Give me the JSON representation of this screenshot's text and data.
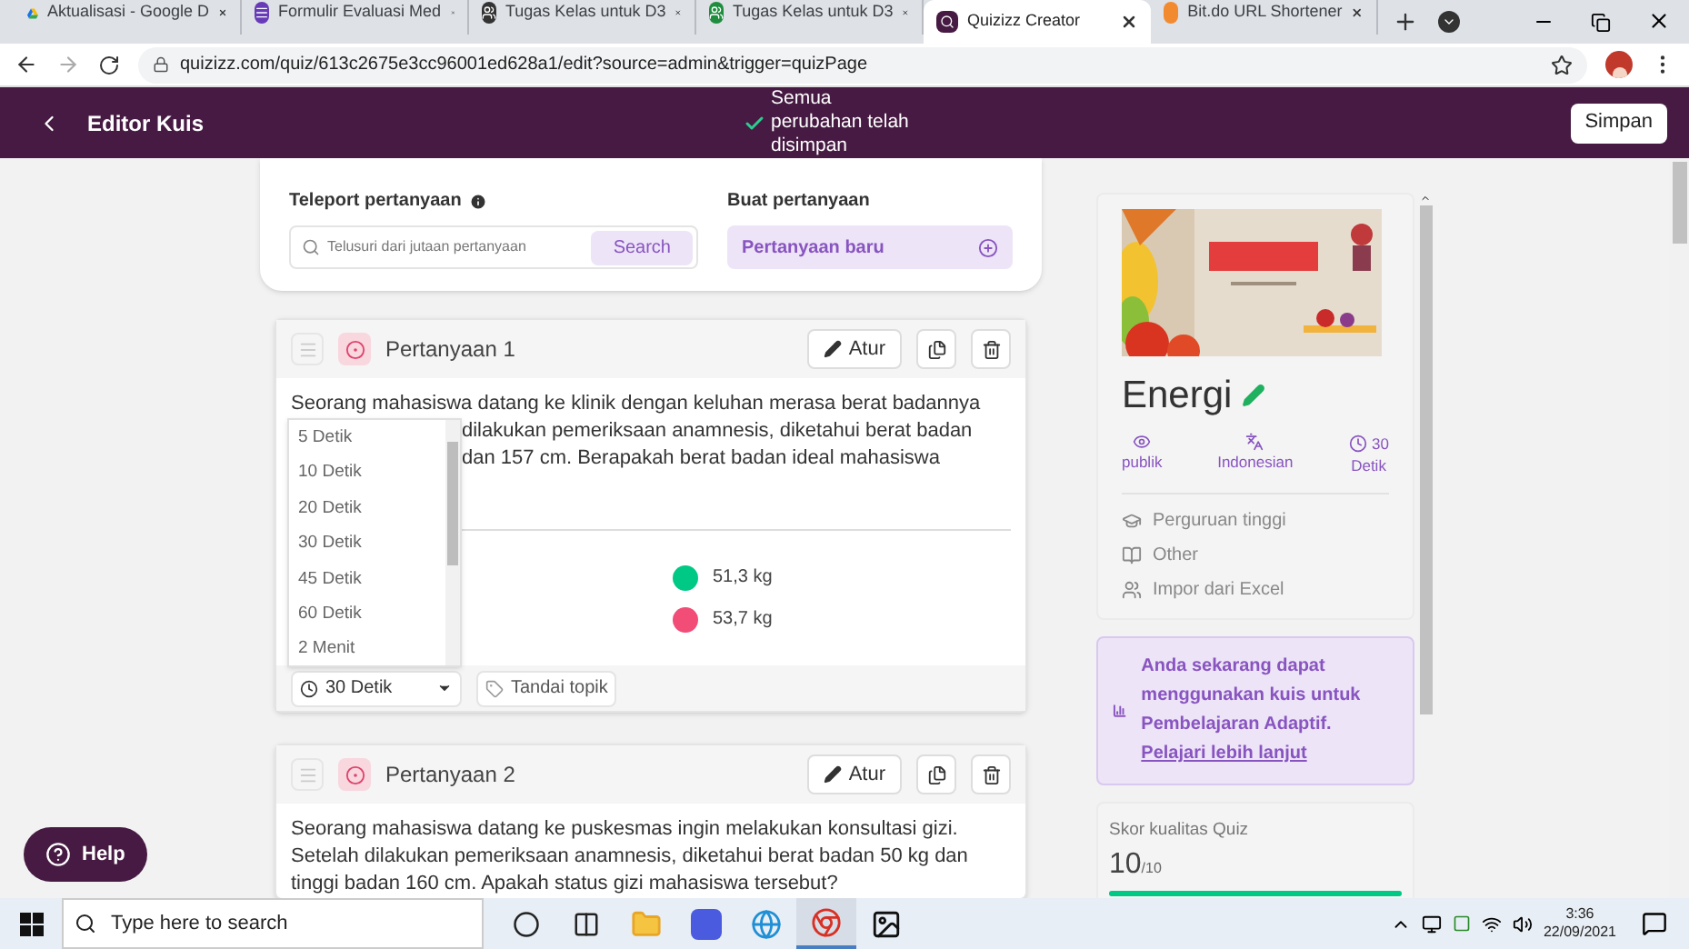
{
  "browser": {
    "tabs": [
      {
        "title": "Aktualisasi - Google D",
        "kind": "drive",
        "selected": false
      },
      {
        "title": "Formulir Evaluasi Med",
        "kind": "form",
        "selected": false
      },
      {
        "title": "Tugas Kelas untuk D3",
        "kind": "classroom-dark",
        "selected": false
      },
      {
        "title": "Tugas Kelas untuk D3",
        "kind": "classroom",
        "selected": false
      },
      {
        "title": "Quizizz Creator",
        "kind": "quiz",
        "selected": true
      },
      {
        "title": "Bit.do URL Shortener",
        "kind": "dot",
        "selected": false
      }
    ],
    "url": "quizizz.com/quiz/613c2675e3cc96001ed628a1/edit?source=admin&trigger=quizPage"
  },
  "header": {
    "title": "Editor Kuis",
    "save_status": "Semua perubahan telah disimpan",
    "save_button": "Simpan"
  },
  "top_panel": {
    "teleport_label": "Teleport pertanyaan",
    "search_placeholder": "Telusuri dari jutaan pertanyaan",
    "search_button": "Search",
    "create_label": "Buat pertanyaan",
    "create_button": "Pertanyaan baru"
  },
  "questions": [
    {
      "title": "Pertanyaan 1",
      "edit_button": "Atur",
      "text_lines": [
        "Seorang mahasiswa datang ke klinik dengan keluhan merasa berat badannya",
        "dilakukan pemeriksaan anamnesis, diketahui berat badan",
        "dan 157 cm. Berapakah berat badan ideal mahasiswa"
      ],
      "answers": [
        {
          "text": "51,3 kg",
          "correct": true
        },
        {
          "text": "53,7 kg",
          "correct": false
        }
      ],
      "time": "30 Detik",
      "topic_button": "Tandai topik",
      "time_menu": {
        "expanded": true,
        "options": [
          "5 Detik",
          "10 Detik",
          "20 Detik",
          "30 Detik",
          "45 Detik",
          "60 Detik",
          "2 Menit"
        ]
      }
    },
    {
      "title": "Pertanyaan 2",
      "edit_button": "Atur",
      "text_lines": [
        "Seorang mahasiswa datang ke puskesmas ingin melakukan konsultasi gizi.",
        "Setelah dilakukan pemeriksaan anamnesis, diketahui berat badan 50 kg dan",
        "tinggi badan 160 cm. Apakah status gizi mahasiswa tersebut?"
      ]
    }
  ],
  "help_button": "Help",
  "quiz_info": {
    "title": "Energi",
    "meta": [
      {
        "kind": "visibility",
        "text": "publik"
      },
      {
        "kind": "language",
        "text": "Indonesian"
      },
      {
        "kind": "time",
        "line1": "30",
        "text": "Detik"
      }
    ],
    "details": [
      {
        "kind": "grade",
        "text": "Perguruan tinggi"
      },
      {
        "kind": "subject",
        "text": "Other"
      },
      {
        "kind": "import",
        "text": "Impor dari Excel"
      }
    ]
  },
  "adaptive": {
    "message": "Anda sekarang dapat menggunakan kuis untuk Pembelajaran Adaptif.",
    "link": "Pelajari lebih lanjut"
  },
  "quality": {
    "label": "Skor kualitas Quiz",
    "score": "10",
    "max": "/10",
    "level": 1
  },
  "taskbar": {
    "search_placeholder": "Type here to search",
    "apps": [
      {
        "kind": "cortana",
        "selected": false
      },
      {
        "kind": "taskview",
        "selected": false
      },
      {
        "kind": "folder",
        "selected": false
      },
      {
        "kind": "app",
        "selected": false
      },
      {
        "kind": "edge",
        "selected": false
      },
      {
        "kind": "chrome",
        "selected": true
      },
      {
        "kind": "photos",
        "selected": false
      }
    ],
    "time": "3:36",
    "date": "22/09/2021"
  }
}
